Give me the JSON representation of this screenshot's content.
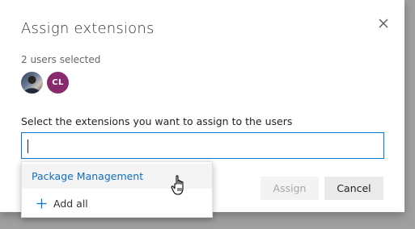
{
  "dialog": {
    "title": "Assign extensions",
    "close_icon": "close-icon",
    "selected_count_text": "2 users selected",
    "users": [
      {
        "type": "photo",
        "icon": "user-photo-avatar"
      },
      {
        "type": "initials",
        "initials": "CL",
        "color": "#8a2a6e"
      }
    ],
    "instruction": "Select the extensions you want to assign to the users",
    "search": {
      "value": "",
      "placeholder": ""
    },
    "suggestions": [
      {
        "label": "Package Management"
      }
    ],
    "add_all": {
      "label": "Add all",
      "icon": "plus-icon"
    },
    "buttons": {
      "assign": {
        "label": "Assign",
        "enabled": false
      },
      "cancel": {
        "label": "Cancel",
        "enabled": true
      }
    }
  },
  "colors": {
    "accent": "#0078d4",
    "link": "#106ebe"
  },
  "pointer": {
    "icon": "hand-pointer-icon"
  }
}
